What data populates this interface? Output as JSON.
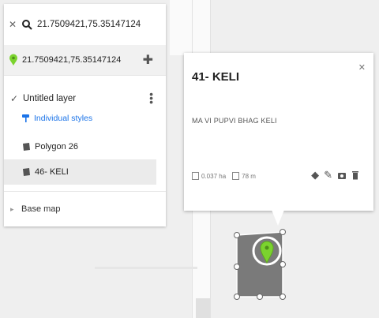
{
  "search": {
    "query": "21.7509421,75.35147124"
  },
  "result": {
    "coords": "21.7509421,75.35147124"
  },
  "layer": {
    "name": "Untitled layer",
    "styles_label": "Individual styles",
    "features": [
      {
        "label": "Polygon 26"
      },
      {
        "label": "46- KELI"
      }
    ]
  },
  "basemap": {
    "label": "Base map"
  },
  "card": {
    "title": "41- KELI",
    "description": "MA VI PUPVI BHAG KELI",
    "area": "0.037 ha",
    "perimeter": "78 m"
  },
  "colors": {
    "marker": "#7bd32e",
    "polygon_fill": "#7a7a7a",
    "link": "#1a73e8"
  }
}
